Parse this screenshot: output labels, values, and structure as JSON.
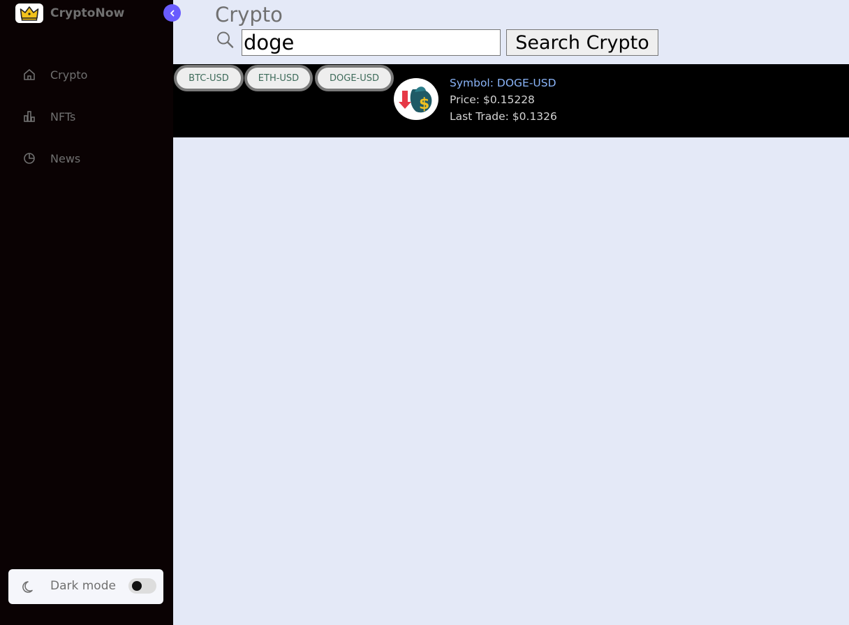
{
  "sidebar": {
    "brand": "CryptoNow",
    "logo_icon": "crown-icon",
    "items": [
      {
        "label": "Crypto",
        "icon": "home-icon"
      },
      {
        "label": "NFTs",
        "icon": "bar-chart-icon"
      },
      {
        "label": "News",
        "icon": "pie-chart-icon"
      }
    ],
    "dark_mode_label": "Dark mode",
    "dark_mode_on": false
  },
  "main": {
    "title": "Crypto",
    "search": {
      "value": "doge",
      "button_label": "Search Crypto"
    },
    "chips": [
      "BTC-USD",
      "ETH-USD",
      "DOGE-USD"
    ],
    "result": {
      "symbol": "Symbol: DOGE-USD",
      "price": "Price: $0.15228",
      "last_trade": "Last Trade: $0.1326"
    }
  },
  "colors": {
    "sidebar_bg": "#0a0203",
    "page_bg": "#e4e9f7",
    "accent": "#695cfe",
    "symbol_link": "#8ab4f8"
  }
}
